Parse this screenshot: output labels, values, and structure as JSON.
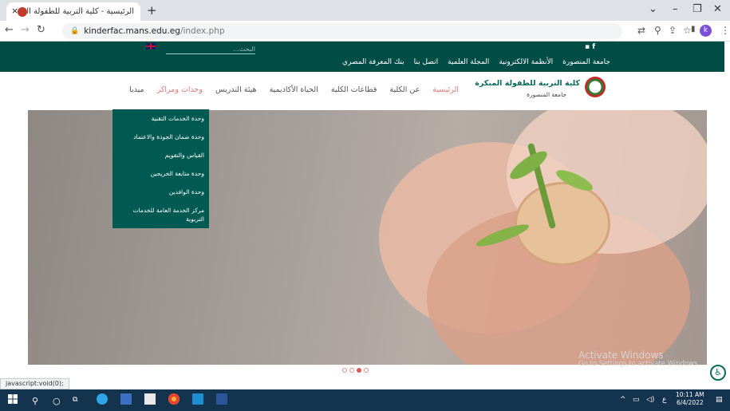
{
  "browser": {
    "tab_title": "الرئيسية - كلية التربية للطفولة المبكـ",
    "tab_close": "×",
    "new_tab": "+",
    "url_host": "kinderfac.mans.edu.eg",
    "url_path": "/index.php",
    "profile_initial": "k",
    "status_text": "javascript:void(0);"
  },
  "site": {
    "search_placeholder": "البحث...",
    "top_links": [
      "جامعة المنصورة",
      "الأنظمة الالكترونية",
      "المجلة العلمية",
      "اتصل بنا",
      "بنك المعرفة المصري"
    ],
    "brand_title": "كلية التربية للطفولة المبكرة",
    "brand_sub": "جامعة المنصورة",
    "nav": [
      "الرئيسية",
      "عن الكلية",
      "قطاعات الكلية",
      "الحياة الأكاديمية",
      "هيئة التدريس",
      "وحدات ومراكز",
      "ميديا"
    ],
    "dropdown": [
      "وحدة الخدمات التقنية",
      "وحدة ضمان الجودة والاعتماد",
      "القياس والتقويم",
      "وحدة متابعة الخريجين",
      "وحدة الوافدين",
      "مركز الخدمة العامة للخدمات التربوية"
    ],
    "slider_total": 4,
    "slider_active_index": 3
  },
  "windows": {
    "activate_title": "Activate Windows",
    "activate_sub": "Go to Settings to activate Windows.",
    "time": "10:11 AM",
    "date": "6/4/2022"
  },
  "colors": {
    "site_bar": "#004d46",
    "dropdown": "#005a52",
    "active_nav": "#e07a7a",
    "taskbar": "#14334f"
  }
}
